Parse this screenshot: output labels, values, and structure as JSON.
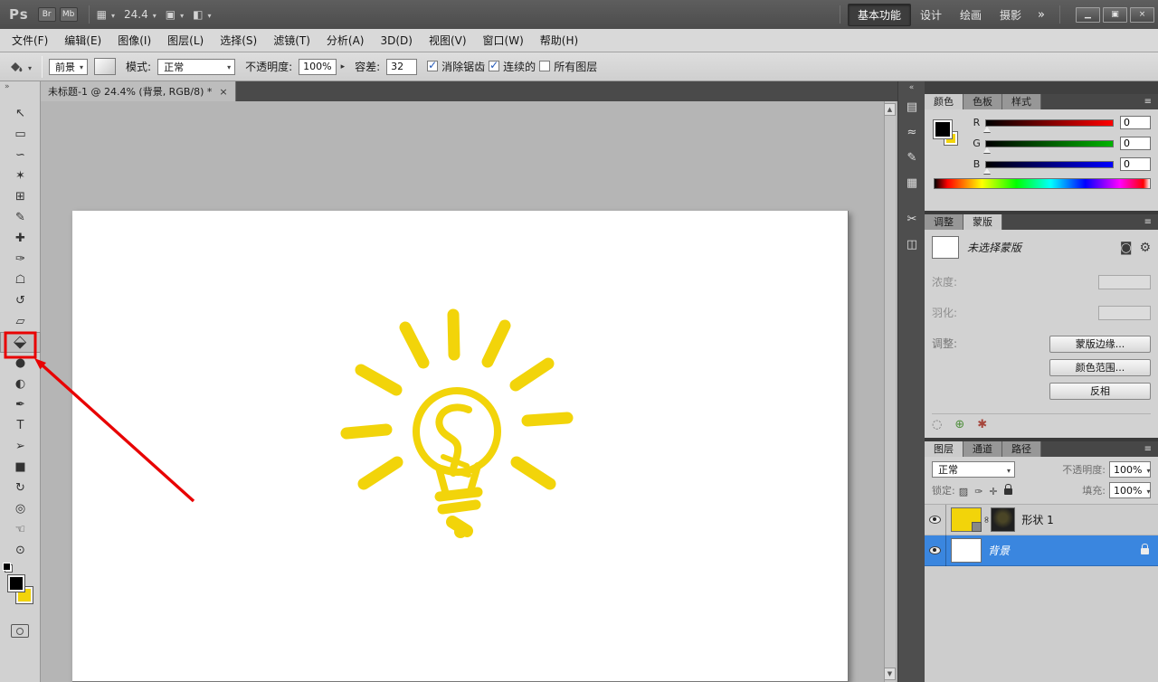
{
  "colors": {
    "accent_red": "#e80202",
    "yellow": "#f2d40a",
    "selection_blue": "#3a86df",
    "foreground": "#000000",
    "background_swatch": "#ffe400"
  },
  "titlebar": {
    "logo": "Ps",
    "bridge_label": "Br",
    "mini_bridge_label": "Mb",
    "layout_icon": "▦",
    "zoom_value": "24.4",
    "extras_icon": "▣",
    "screen_mode_icon": "◧",
    "workspaces": [
      "基本功能",
      "设计",
      "绘画",
      "摄影"
    ],
    "active_workspace": "基本功能",
    "workspace_overflow": "»",
    "window_controls": [
      {
        "name": "minimize-button",
        "glyph": "▁"
      },
      {
        "name": "restore-button",
        "glyph": "▣"
      },
      {
        "name": "close-button",
        "glyph": "×"
      }
    ]
  },
  "menubar": {
    "items": [
      "文件(F)",
      "编辑(E)",
      "图像(I)",
      "图层(L)",
      "选择(S)",
      "滤镜(T)",
      "分析(A)",
      "3D(D)",
      "视图(V)",
      "窗口(W)",
      "帮助(H)"
    ]
  },
  "optionsbar": {
    "fill_source": "前景",
    "mode_label": "模式:",
    "mode_value": "正常",
    "opacity_label": "不透明度:",
    "opacity_value": "100%",
    "tolerance_label": "容差:",
    "tolerance_value": "32",
    "checkboxes": [
      {
        "label": "消除锯齿",
        "checked": true
      },
      {
        "label": "连续的",
        "checked": true
      },
      {
        "label": "所有图层",
        "checked": false
      }
    ]
  },
  "toolbar": {
    "collapse_glyph": "»",
    "tools": [
      {
        "name": "move",
        "glyph": "↖"
      },
      {
        "name": "rect-marquee",
        "glyph": "▭"
      },
      {
        "name": "lasso",
        "glyph": "∽"
      },
      {
        "name": "quick-selection",
        "glyph": "✶"
      },
      {
        "name": "crop",
        "glyph": "⊞"
      },
      {
        "name": "eyedropper",
        "glyph": "✎"
      },
      {
        "name": "spot-healing",
        "glyph": "✚"
      },
      {
        "name": "brush",
        "glyph": "✑"
      },
      {
        "name": "clone-stamp",
        "glyph": "☖"
      },
      {
        "name": "history-brush",
        "glyph": "↺"
      },
      {
        "name": "eraser",
        "glyph": "▱"
      },
      {
        "name": "paint-bucket",
        "glyph": "◪",
        "rot": true,
        "active": true
      },
      {
        "name": "blur",
        "glyph": "●"
      },
      {
        "name": "dodge",
        "glyph": "◐"
      },
      {
        "name": "pen",
        "glyph": "✒"
      },
      {
        "name": "type",
        "glyph": "T"
      },
      {
        "name": "path-selection",
        "glyph": "➢"
      },
      {
        "name": "shape",
        "glyph": "■"
      },
      {
        "name": "3d-rotate",
        "glyph": "↻"
      },
      {
        "name": "3d-orbit",
        "glyph": "◎"
      },
      {
        "name": "hand",
        "glyph": "☜"
      },
      {
        "name": "zoom",
        "glyph": "⊙"
      }
    ]
  },
  "document": {
    "tab_title": "未标题-1 @ 24.4% (背景, RGB/8) *",
    "close_glyph": "×",
    "scroll_up_glyph": "▲",
    "scroll_down_glyph": "▼"
  },
  "collapsed_panels": {
    "expand_glyph": "«",
    "icons": [
      {
        "name": "panel-icon-adjustments",
        "glyph": "▤"
      },
      {
        "name": "panel-icon-waves",
        "glyph": "≈"
      },
      {
        "name": "panel-icon-pen",
        "glyph": "✎"
      },
      {
        "name": "panel-icon-grid",
        "glyph": "▦"
      },
      {
        "name": "panel-icon-scissors",
        "glyph": "✂"
      },
      {
        "name": "panel-icon-half-square",
        "glyph": "◫"
      }
    ]
  },
  "color_panel": {
    "tabs": [
      "颜色",
      "色板",
      "样式"
    ],
    "active_tab": "颜色",
    "menu_icon": "≡",
    "channels": [
      {
        "label": "R",
        "value": "0",
        "from": "#000000",
        "to": "#ff0000"
      },
      {
        "label": "G",
        "value": "0",
        "from": "#000000",
        "to": "#00b400"
      },
      {
        "label": "B",
        "value": "0",
        "from": "#000000",
        "to": "#0000ff"
      }
    ]
  },
  "mask_panel": {
    "tabs": [
      "调整",
      "蒙版"
    ],
    "active_tab": "蒙版",
    "menu_icon": "≡",
    "status_text": "未选择蒙版",
    "pixel_mask_icon": "◙",
    "vector_mask_icon": "⚙",
    "density_label": "浓度:",
    "feather_label": "羽化:",
    "adjust_label": "调整:",
    "buttons": [
      "蒙版边缘...",
      "颜色范围...",
      "反相"
    ],
    "footer_icons": [
      {
        "name": "load-selection-icon",
        "glyph": "◌",
        "color": "#6f6f6f"
      },
      {
        "name": "apply-mask-icon",
        "glyph": "⊕",
        "color": "#4f8f3c"
      },
      {
        "name": "delete-mask-icon",
        "glyph": "✱",
        "color": "#a6463c"
      }
    ]
  },
  "layers_panel": {
    "tabs": [
      "图层",
      "通道",
      "路径"
    ],
    "active_tab": "图层",
    "menu_icon": "≡",
    "blend_mode": "正常",
    "opacity_label": "不透明度:",
    "opacity_value": "100%",
    "lock_label": "锁定:",
    "fill_label": "填充:",
    "fill_value": "100%",
    "link_icon": "∞",
    "lock_icons": [
      {
        "name": "lock-transparent-icon",
        "glyph": "▨"
      },
      {
        "name": "lock-image-icon",
        "glyph": "✑"
      },
      {
        "name": "lock-position-icon",
        "glyph": "✛"
      },
      {
        "name": "lock-all-icon",
        "css": "lock"
      }
    ],
    "rows": [
      {
        "name": "形状 1",
        "kind": "shape",
        "selected": false,
        "visible": true,
        "linked": true
      },
      {
        "name": "背景",
        "kind": "background",
        "selected": true,
        "visible": true,
        "locked": true
      }
    ]
  },
  "annotation": {
    "type": "highlight-arrow",
    "target": "paint-bucket-tool"
  }
}
